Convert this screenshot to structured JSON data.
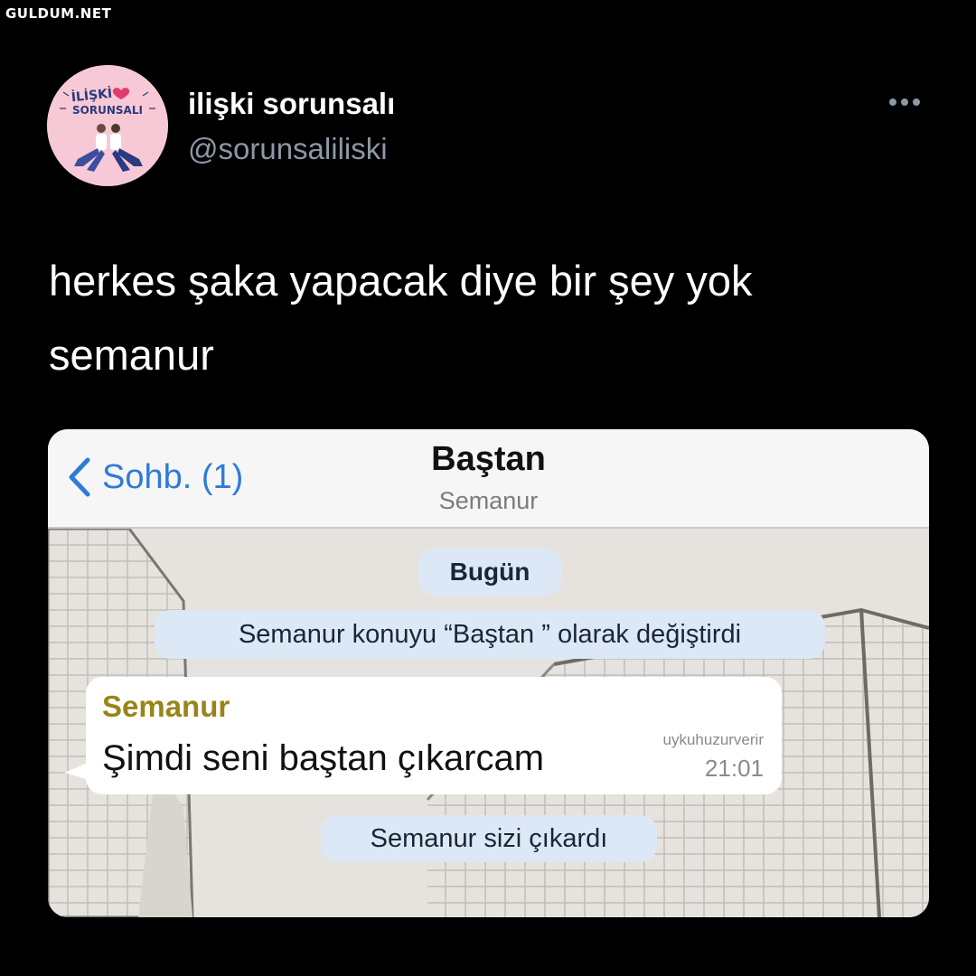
{
  "watermark": "GULDUM.NET",
  "avatar": {
    "logo_line1": "İLİŞKİ",
    "logo_line2": "SORUNSALI",
    "accent": "#f7c9d6"
  },
  "author": {
    "name": "ilişki sorunsalı",
    "handle": "@sorunsaliliski"
  },
  "more_icon": "ellipsis-icon",
  "tweet": {
    "line1": "herkes şaka yapacak diye bir şey yok",
    "line2": "semanur"
  },
  "chat": {
    "back_label": "Sohb. (1)",
    "title": "Baştan",
    "subtitle": "Semanur",
    "date_pill": "Bugün",
    "topic_change": "Semanur konuyu “Baştan ” olarak değiştirdi",
    "message": {
      "sender": "Semanur",
      "text": "Şimdi seni baştan çıkarcam",
      "meta": "uykuhuzurverir",
      "time": "21:01"
    },
    "removed": "Semanur sizi çıkardı"
  },
  "colors": {
    "background": "#000000",
    "handle": "#8b98a5",
    "link": "#2e7bd8",
    "sender": "#9a8419"
  }
}
